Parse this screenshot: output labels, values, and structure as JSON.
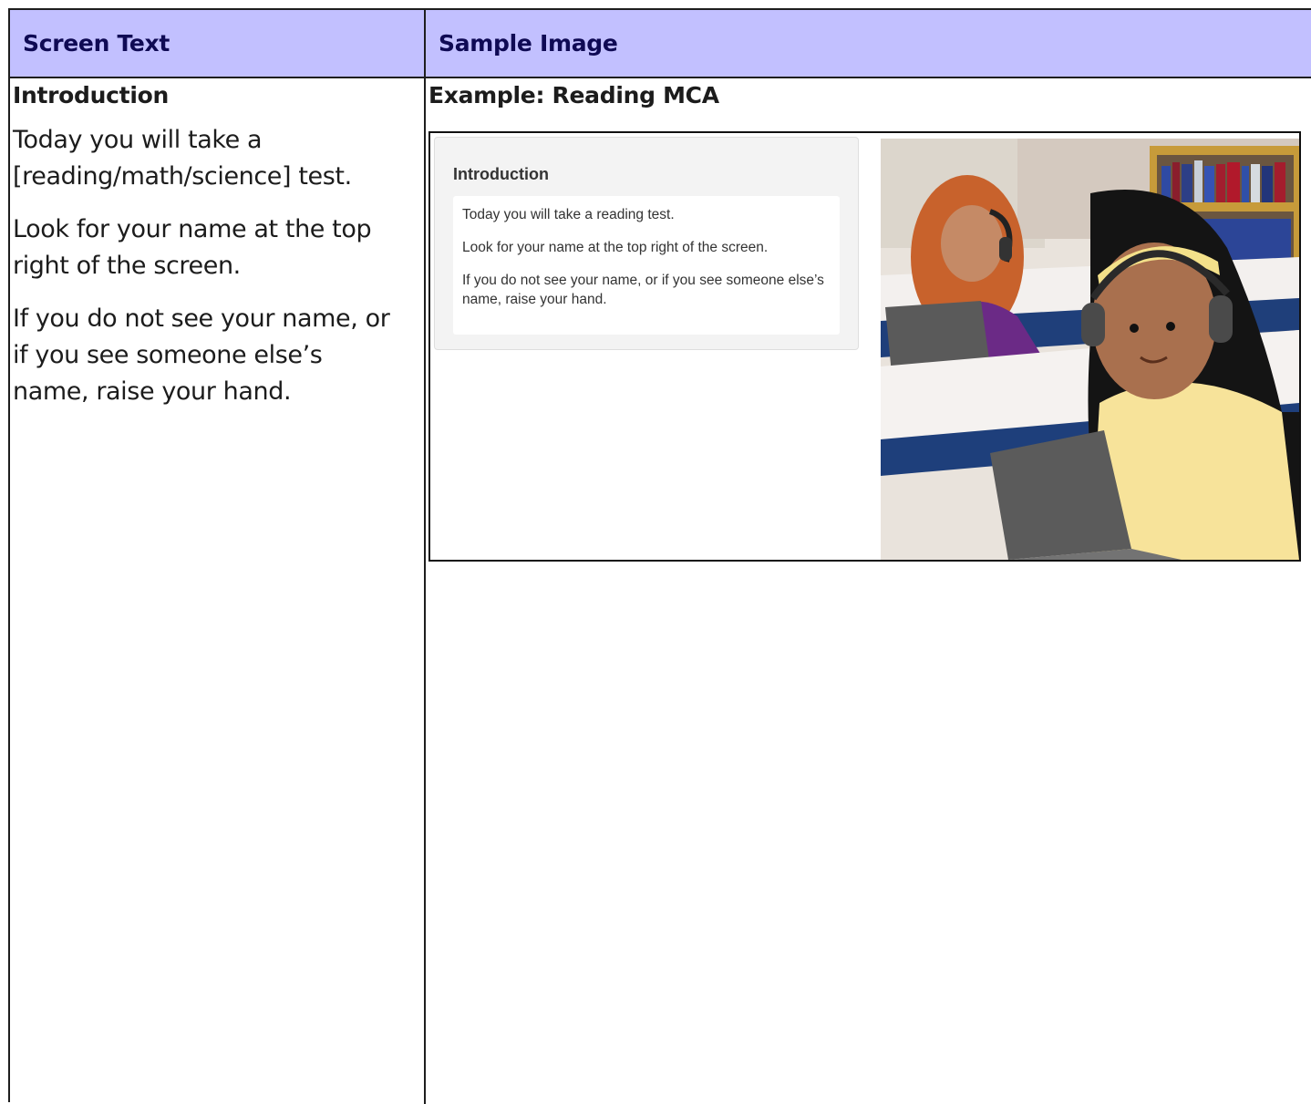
{
  "table": {
    "header": {
      "left": "Screen Text",
      "right": "Sample Image"
    },
    "left_cell": {
      "heading": "Introduction",
      "paragraphs": [
        "Today you will take a [reading/math/science] test.",
        "Look for your name at the top right of the screen.",
        "If you do not see your name, or if you see someone else’s name, raise your hand."
      ]
    },
    "right_cell": {
      "heading": "Example: Reading MCA",
      "sample_screen": {
        "title": "Introduction",
        "paragraphs": [
          "Today you will take a reading test.",
          "Look for your name at the top right of the screen.",
          "If you do not see your name, or if you see someone else’s name, raise your hand."
        ],
        "illustration": "students-wearing-headphones-using-laptops"
      }
    }
  },
  "colors": {
    "header_background": "#c2c0ff",
    "header_text": "#0f0a54",
    "border": "#1e1e1e"
  }
}
